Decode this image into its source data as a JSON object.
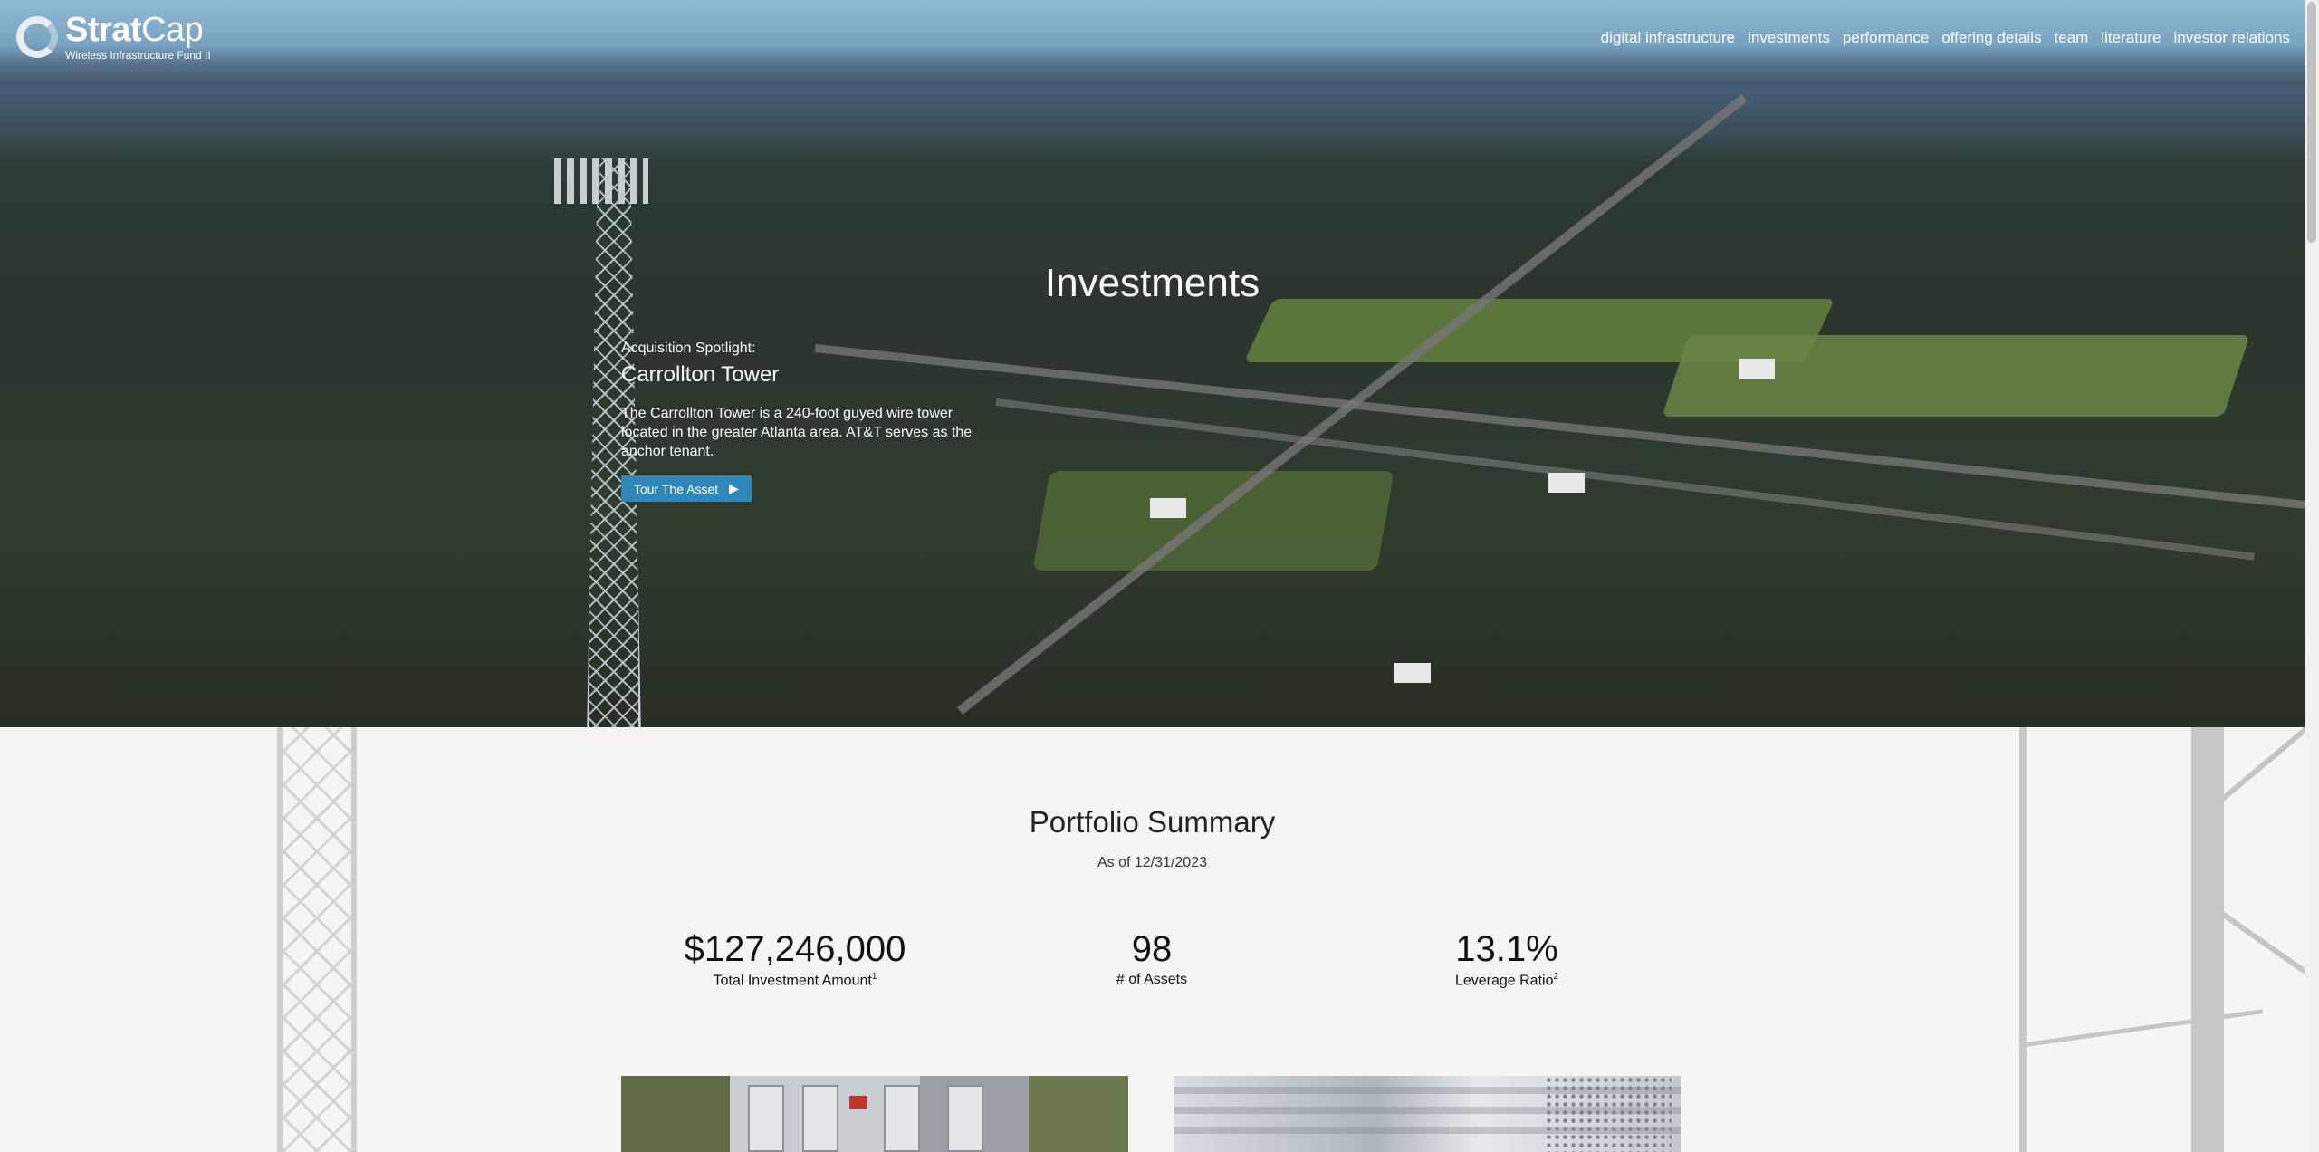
{
  "logo": {
    "brand_bold": "Strat",
    "brand_light": "Cap",
    "subtitle": "Wireless Infrastructure Fund II"
  },
  "nav": {
    "items": [
      {
        "label": "digital infrastructure"
      },
      {
        "label": "investments"
      },
      {
        "label": "performance"
      },
      {
        "label": "offering details"
      },
      {
        "label": "team"
      },
      {
        "label": "literature"
      },
      {
        "label": "investor relations"
      }
    ]
  },
  "hero": {
    "title": "Investments",
    "spotlight_label": "Acquisition Spotlight:",
    "spotlight_name": "Carrollton Tower",
    "spotlight_description": "The Carrollton Tower is a 240-foot guyed wire tower located in the greater Atlanta area. AT&T serves as the anchor tenant.",
    "button_label": "Tour The Asset",
    "button_icon": "play-icon"
  },
  "summary": {
    "title": "Portfolio Summary",
    "as_of": "As of 12/31/2023",
    "stats": [
      {
        "value": "$127,246,000",
        "label": "Total Investment Amount",
        "footnote": "1"
      },
      {
        "value": "98",
        "label": "# of Assets",
        "footnote": ""
      },
      {
        "value": "13.1%",
        "label": "Leverage Ratio",
        "footnote": "2"
      }
    ]
  },
  "colors": {
    "accent": "#2f87b8",
    "background": "#f7f5f3"
  }
}
